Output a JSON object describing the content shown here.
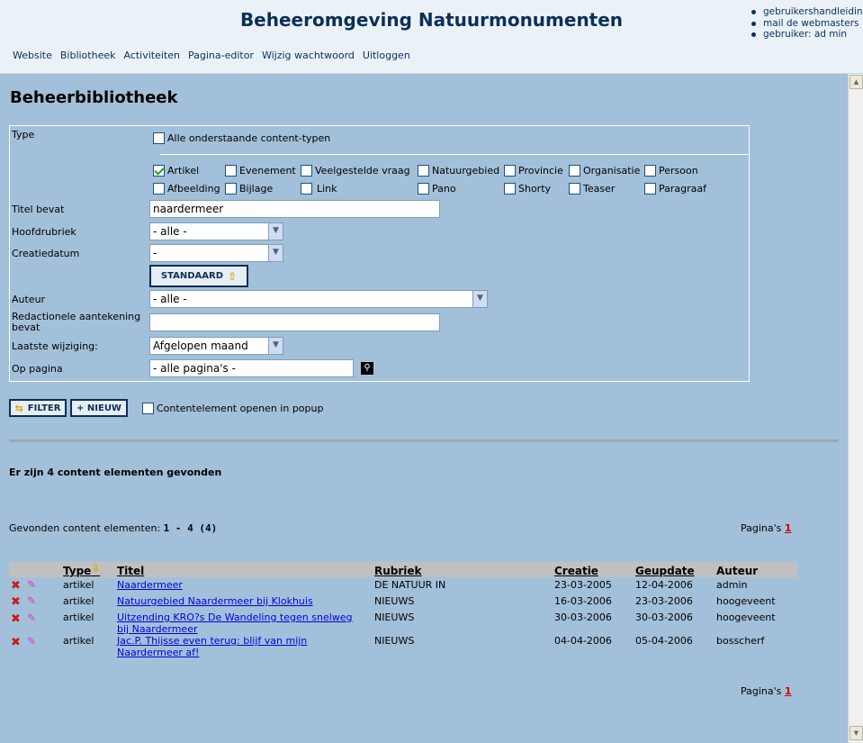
{
  "header": {
    "site_title": "Beheeromgeving Natuurmonumenten",
    "nav": [
      "Website",
      "Bibliotheek",
      "Activiteiten",
      "Pagina-editor",
      "Wijzig wachtwoord",
      "Uitloggen"
    ],
    "util_links": [
      "gebruikershandleiding",
      "mail de webmasters",
      "gebruiker: ad min"
    ]
  },
  "page_title": "Beheerbibliotheek",
  "filter": {
    "type_label": "Type",
    "all_types_label": "Alle onderstaande content-typen",
    "types_row1": [
      {
        "label": "Artikel",
        "checked": true
      },
      {
        "label": "Evenement",
        "checked": false
      },
      {
        "label": "Veelgestelde vraag",
        "checked": false
      },
      {
        "label": "Natuurgebied",
        "checked": false
      },
      {
        "label": "Provincie",
        "checked": false
      },
      {
        "label": "Organisatie",
        "checked": false
      },
      {
        "label": "Persoon",
        "checked": false
      }
    ],
    "types_row2": [
      {
        "label": "Afbeelding",
        "checked": false
      },
      {
        "label": "Bijlage",
        "checked": false
      },
      {
        "label": "Link",
        "checked": false
      },
      {
        "label": "Pano",
        "checked": false
      },
      {
        "label": "Shorty",
        "checked": false
      },
      {
        "label": "Teaser",
        "checked": false
      },
      {
        "label": "Paragraaf",
        "checked": false
      }
    ],
    "titel_label": "Titel bevat",
    "titel_value": "naardermeer",
    "hoofdrubriek_label": "Hoofdrubriek",
    "hoofdrubriek_value": "- alle -",
    "creatiedatum_label": "Creatiedatum",
    "creatiedatum_value": "-",
    "standaard_button": "STANDAARD",
    "auteur_label": "Auteur",
    "auteur_value": "- alle -",
    "redactie_label_1": "Redactionele aantekening",
    "redactie_label_2": "bevat",
    "redactie_value": "",
    "laatste_label": "Laatste wijziging:",
    "laatste_value": "Afgelopen maand",
    "oppagina_label": "Op pagina",
    "oppagina_value": "- alle pagina's -"
  },
  "actions": {
    "filter_button": "FILTER",
    "nieuw_button": "+ NIEUW",
    "popup_label": "Contentelement openen in popup"
  },
  "results": {
    "found_text": "Er zijn 4 content elementen gevonden",
    "range_label": "Gevonden content elementen:",
    "range_value": "1 - 4 (4)",
    "pages_label": "Pagina's",
    "page_number": "1",
    "columns": [
      "Type",
      "Titel",
      "Rubriek",
      "Creatie",
      "Geupdate",
      "Auteur"
    ],
    "rows": [
      {
        "type": "artikel",
        "titel_1": "Naardermeer",
        "titel_2": "",
        "rubriek": "DE NATUUR IN",
        "creatie": "23-03-2005",
        "geupdate": "12-04-2006",
        "auteur": "admin"
      },
      {
        "type": "artikel",
        "titel_1": "Natuurgebied Naardermeer bij Klokhuis",
        "titel_2": "",
        "rubriek": "NIEUWS",
        "creatie": "16-03-2006",
        "geupdate": "23-03-2006",
        "auteur": "hoogeveent"
      },
      {
        "type": "artikel",
        "titel_1": "Uitzending KRO?s De Wandeling tegen snelweg",
        "titel_2": "bij Naardermeer",
        "rubriek": "NIEUWS",
        "creatie": "30-03-2006",
        "geupdate": "30-03-2006",
        "auteur": "hoogeveent"
      },
      {
        "type": "artikel",
        "titel_1": "Jac.P. Thijsse even terug: blijf van mijn",
        "titel_2": "Naardermeer af!",
        "rubriek": "NIEUWS",
        "creatie": "04-04-2006",
        "geupdate": "05-04-2006",
        "auteur": "bosscherf"
      }
    ]
  }
}
